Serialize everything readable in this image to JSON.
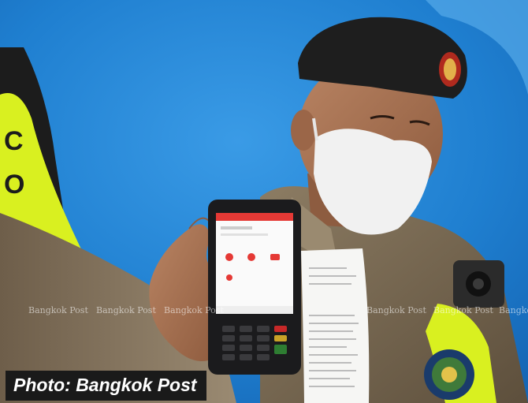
{
  "caption": "Photo: Bangkok Post",
  "watermark": "Bangkok Post",
  "colors": {
    "background_blue": "#1f7fd0",
    "vest_yellow": "#d9f020",
    "uniform_khaki": "#7b6a52",
    "beret": "#1e1e1e",
    "mask": "#f1f1f1",
    "device_red": "#e53935",
    "caption_bg": "#1a1a1a"
  }
}
